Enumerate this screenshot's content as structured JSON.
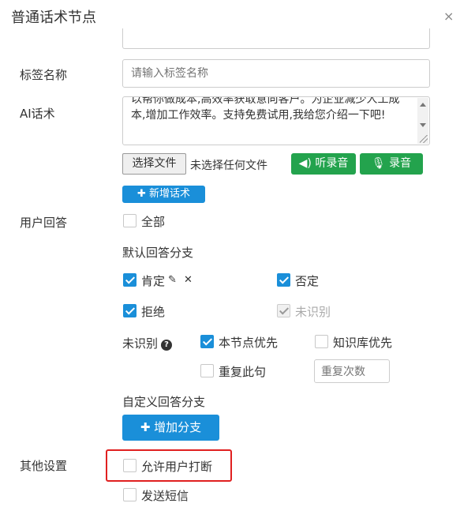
{
  "dialog": {
    "title": "普通话术节点",
    "close_icon": "×"
  },
  "fields": {
    "tag_name": {
      "label": "标签名称",
      "placeholder": "请输入标签名称"
    },
    "ai_script": {
      "label": "AI话术",
      "text": "以帮你做成本,高效率获取意向客户。为企业减少人工成本,增加工作效率。支持免费试用,我给您介绍一下吧!"
    }
  },
  "file": {
    "choose_label": "选择文件",
    "status": "未选择任何文件"
  },
  "buttons": {
    "listen": "听录音",
    "record": "录音",
    "add_script": "新增话术",
    "add_branch": "增加分支"
  },
  "user_reply": {
    "label": "用户回答",
    "all": "全部",
    "default_branch_heading": "默认回答分支",
    "options": {
      "affirm": "肯定",
      "deny": "否定",
      "reject": "拒绝",
      "unrecognized": "未识别"
    },
    "unrecognized_row": {
      "label": "未识别",
      "node_first": "本节点优先",
      "kb_first": "知识库优先",
      "repeat": "重复此句",
      "repeat_count_placeholder": "重复次数"
    },
    "custom_branch_heading": "自定义回答分支"
  },
  "other_settings": {
    "label": "其他设置",
    "allow_interrupt": "允许用户打断",
    "send_sms": "发送短信"
  }
}
